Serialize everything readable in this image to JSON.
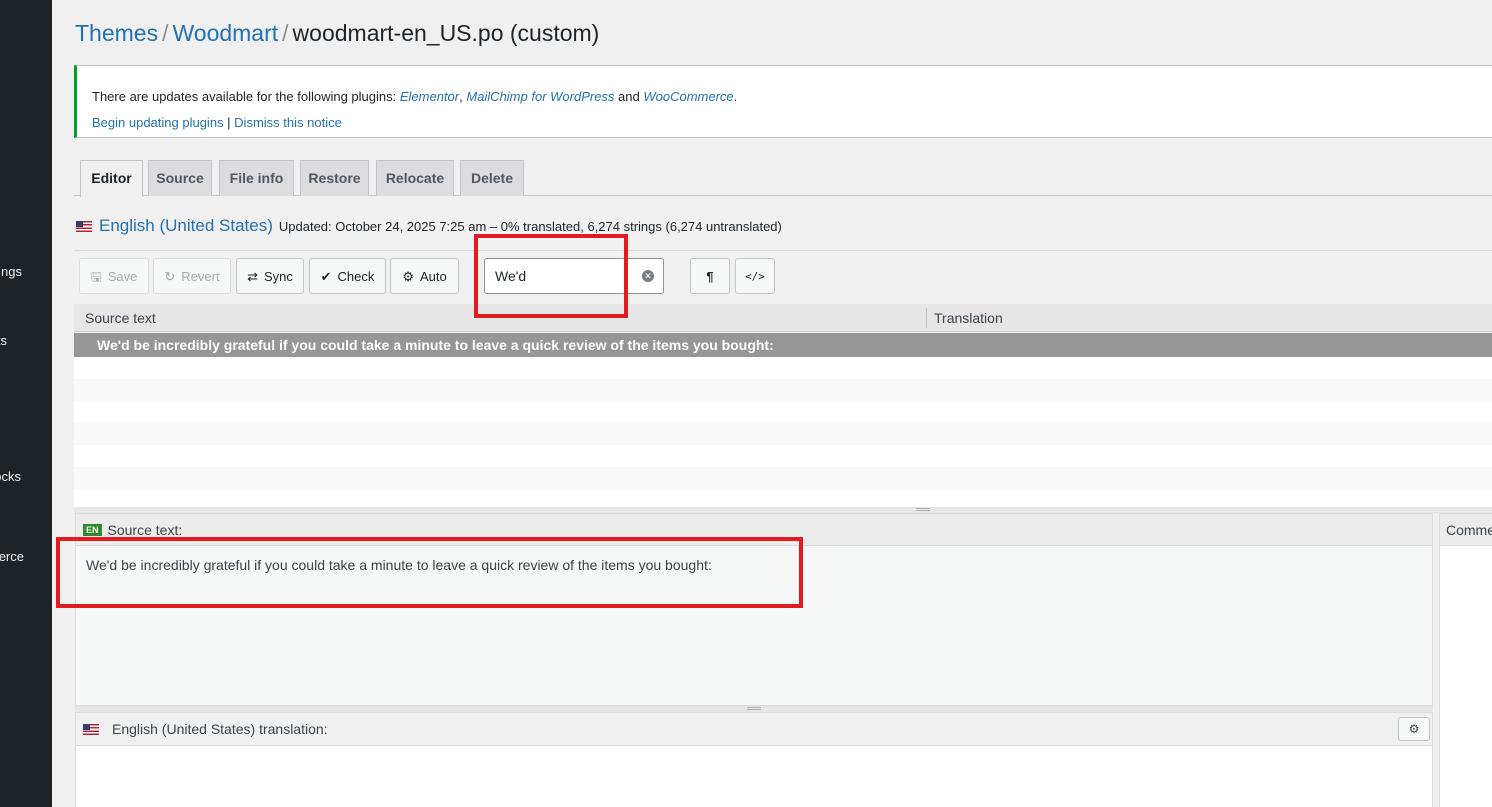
{
  "sidebar": {
    "items": [
      "ngs",
      "ts",
      "ocks",
      "erce"
    ]
  },
  "breadcrumb": {
    "themes": "Themes",
    "woodmart": "Woodmart",
    "file": "woodmart-en_US.po (custom)",
    "separator": "/"
  },
  "notice": {
    "text_prefix": "There are updates available for the following plugins: ",
    "plugin1": "Elementor",
    "comma": ", ",
    "plugin2": "MailChimp for WordPress",
    "and": " and ",
    "plugin3": "WooCommerce",
    "period": ".",
    "begin_link": "Begin updating plugins",
    "pipe": " | ",
    "dismiss_link": "Dismiss this notice",
    "border_color": "#00a32a"
  },
  "tabs": [
    "Editor",
    "Source",
    "File info",
    "Restore",
    "Relocate",
    "Delete"
  ],
  "language": {
    "name": "English (United States)",
    "status": "Updated: October 24, 2025 7:25 am – 0% translated, 6,274 strings (6,274 untranslated)"
  },
  "toolbar": {
    "save": "Save",
    "revert": "Revert",
    "sync": "Sync",
    "check": "Check",
    "auto": "Auto",
    "search_value": "We'd",
    "pilcrow_glyph": "¶",
    "code_glyph": "</>"
  },
  "grid": {
    "col_source": "Source text",
    "col_translation": "Translation",
    "selected_row": "We'd be incredibly grateful if you could take a minute to leave a quick review of the items you bought:"
  },
  "source_pane": {
    "badge": "EN",
    "label": "Source text:",
    "text": "We'd be incredibly grateful if you could take a minute to leave a quick review of the items you bought:"
  },
  "comments_pane": {
    "label": "Comme"
  },
  "translation_pane": {
    "label": "English (United States) translation:"
  },
  "colors": {
    "link": "#2271b1",
    "highlight": "#e11b22",
    "selected_row": "#969696"
  }
}
